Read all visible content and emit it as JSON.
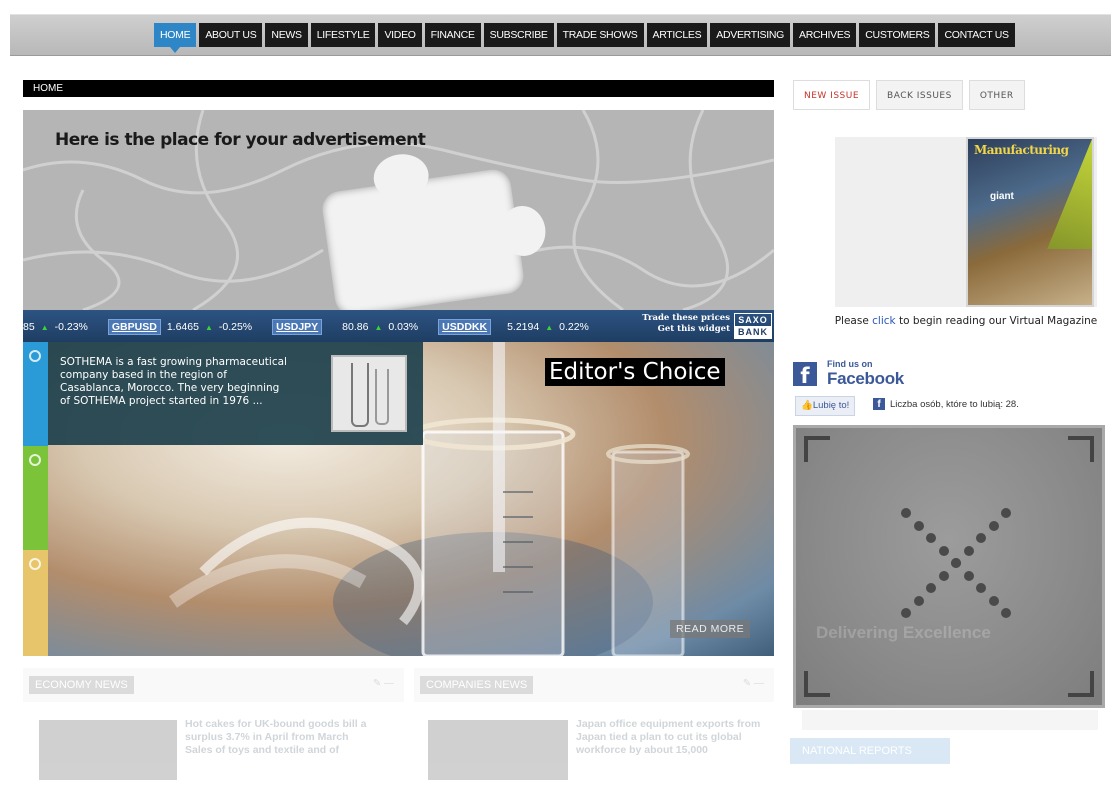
{
  "nav": {
    "items": [
      "HOME",
      "ABOUT US",
      "NEWS",
      "LIFESTYLE",
      "VIDEO",
      "FINANCE",
      "SUBSCRIBE",
      "TRADE SHOWS",
      "ARTICLES",
      "ADVERTISING",
      "ARCHIVES",
      "CUSTOMERS",
      "CONTACT US"
    ],
    "active": "HOME"
  },
  "breadcrumb": "HOME",
  "ad": {
    "text": "Here is the place for your advertisement"
  },
  "ticker": {
    "lead": "85",
    "lead_change": "-0.23%",
    "quotes": [
      {
        "symbol": "GBPUSD",
        "price": "1.6465",
        "change": "-0.25%"
      },
      {
        "symbol": "USDJPY",
        "price": "80.86",
        "change": "0.03%"
      },
      {
        "symbol": "USDDKK",
        "price": "5.2194",
        "change": "0.22%"
      }
    ],
    "trade_line1": "Trade these prices",
    "trade_line2": "Get this widget",
    "brand_top": "SAXO",
    "brand_bottom": "BANK"
  },
  "featured": {
    "description": "SOTHEMA is a fast growing pharmaceutical company based in the region of Casablanca, Morocco. The very beginning of SOTHEMA project started in 1976 ...",
    "badge": "Editor's Choice",
    "read_more": "READ MORE",
    "strip_colors": [
      "#2a9bd6",
      "#7bc43a",
      "#e7c56a"
    ]
  },
  "news": {
    "economy": {
      "header": "ECONOMY NEWS",
      "text": "Hot cakes for UK-bound goods bill a surplus 3.7% in April from March Sales of toys and textile and of"
    },
    "companies": {
      "header": "COMPANIES NEWS",
      "text": "Japan office equipment exports from Japan tied a plan to cut its global workforce by about 15,000"
    }
  },
  "tabs": [
    "NEW ISSUE",
    "BACK ISSUES",
    "OTHER"
  ],
  "active_tab": "NEW ISSUE",
  "magazine": {
    "cover_title": "Manufacturing",
    "cover_sub": "giant",
    "caption_pre": "Please",
    "caption_link": "click",
    "caption_post": "to begin reading our Virtual Magazine"
  },
  "facebook": {
    "find_us": "Find us on",
    "name": "Facebook",
    "like_button": "Lubię to!",
    "like_count_text": "Liczba osób, które to lubią: 28."
  },
  "video": {
    "watermark": "Delivering Excellence"
  },
  "bottom_right": {
    "bar": "NATIONAL REPORTS"
  }
}
